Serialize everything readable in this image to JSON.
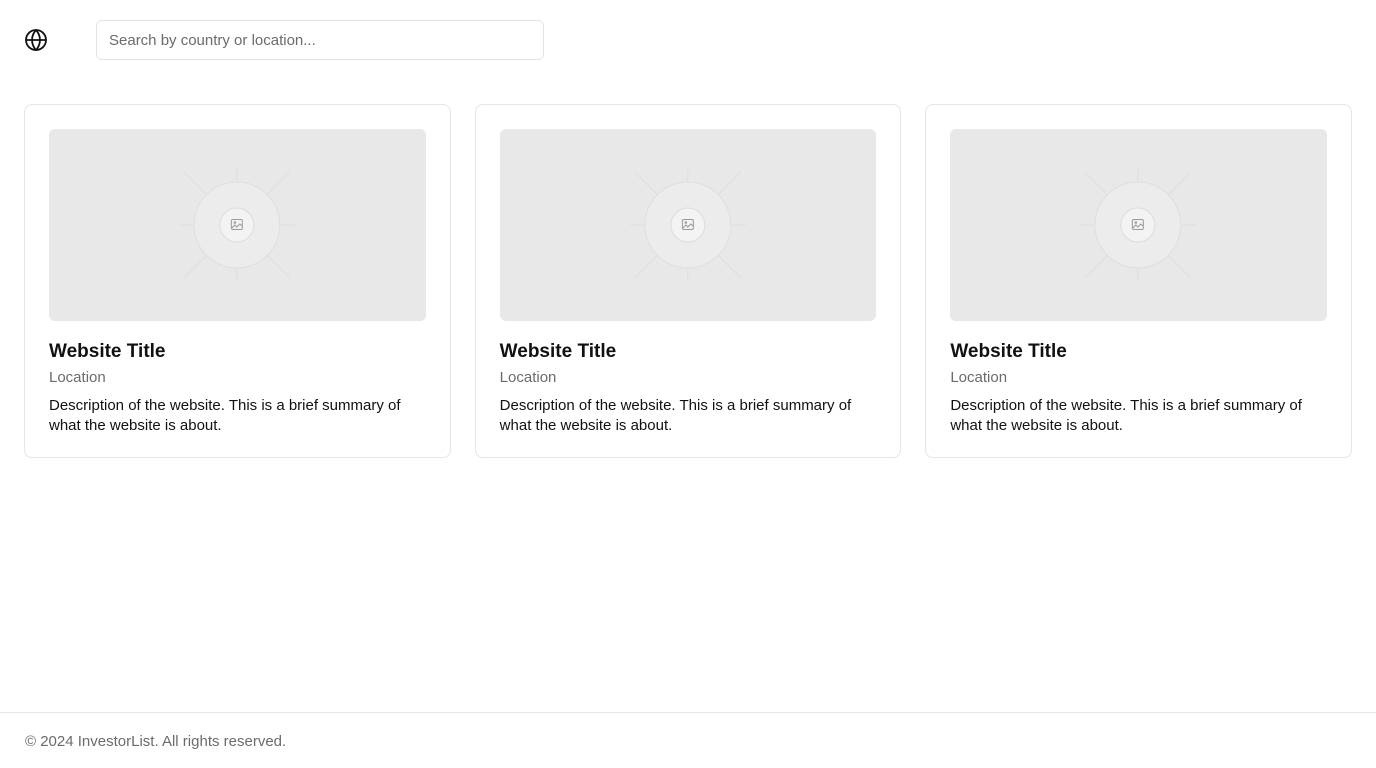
{
  "header": {
    "logo_icon": "globe-icon",
    "search": {
      "placeholder": "Search by country or location...",
      "value": ""
    }
  },
  "cards": [
    {
      "image_icon": "image-placeholder-icon",
      "title": "Website Title",
      "location": "Location",
      "description": "Description of the website. This is a brief summary of what the website is about."
    },
    {
      "image_icon": "image-placeholder-icon",
      "title": "Website Title",
      "location": "Location",
      "description": "Description of the website. This is a brief summary of what the website is about."
    },
    {
      "image_icon": "image-placeholder-icon",
      "title": "Website Title",
      "location": "Location",
      "description": "Description of the website. This is a brief summary of what the website is about."
    }
  ],
  "footer": {
    "copyright": "© 2024 InvestorList. All rights reserved."
  },
  "colors": {
    "border": "#e5e5e5",
    "placeholder_bg": "#e8e8e8",
    "muted_text": "#6b6b6b",
    "text": "#111111"
  }
}
